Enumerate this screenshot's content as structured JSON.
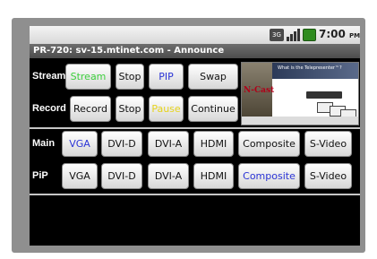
{
  "status_bar": {
    "network_label": "3G",
    "time": "7:00",
    "ampm": "PM",
    "icons": [
      "network-3g-icon",
      "signal-bars-icon",
      "battery-icon"
    ],
    "battery_color": "#2e8b1e"
  },
  "title": "PR-720: sv-15.mtinet.com - Announce",
  "rows": {
    "stream": {
      "label": "Stream",
      "buttons": [
        "Stream",
        "Stop",
        "PIP",
        "Swap"
      ]
    },
    "record": {
      "label": "Record",
      "buttons": [
        "Record",
        "Stop",
        "Pause",
        "Continue"
      ]
    },
    "main": {
      "label": "Main",
      "buttons": [
        "VGA",
        "DVI-D",
        "DVI-A",
        "HDMI",
        "Composite",
        "S-Video"
      ]
    },
    "pip": {
      "label": "PiP",
      "buttons": [
        "VGA",
        "DVI-D",
        "DVI-A",
        "HDMI",
        "Composite",
        "S-Video"
      ]
    }
  },
  "preview": {
    "header": "What is the Telepresenter™?",
    "logo": "N-Cast"
  },
  "colors": {
    "active_green": "#3ecf3e",
    "active_blue": "#2b34d6",
    "pause_yellow": "#e6d31e",
    "title_bg": "#5a5a5a"
  }
}
